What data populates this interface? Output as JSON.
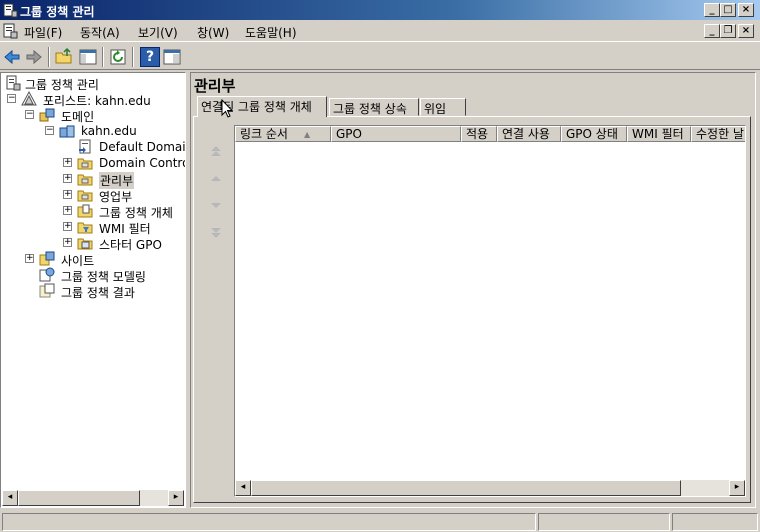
{
  "window": {
    "title": "그룹 정책 관리",
    "minimize": "_",
    "maximize": "□",
    "close": "×",
    "doc_minimize": "_",
    "doc_restore": "❐",
    "doc_close": "×"
  },
  "menu": [
    "파일(F)",
    "동작(A)",
    "보기(V)",
    "창(W)",
    "도움말(H)"
  ],
  "toolbar": {
    "back": "back-arrow-icon",
    "forward": "forward-arrow-icon",
    "up": "up-folder-icon",
    "show_hide_tree": "console-tree-icon",
    "refresh": "refresh-icon",
    "help": "?",
    "properties": "properties-pane-icon"
  },
  "tree": [
    {
      "label": "그룹 정책 관리",
      "icon": "gpmc-root-icon",
      "expander": ""
    },
    {
      "label": "포리스트: kahn.edu",
      "icon": "forest-icon",
      "expander": "−"
    },
    {
      "label": "도메인",
      "icon": "domains-icon",
      "expander": "−"
    },
    {
      "label": "kahn.edu",
      "icon": "domain-icon",
      "expander": "−"
    },
    {
      "label": "Default Domain",
      "icon": "gpo-link-icon",
      "expander": ""
    },
    {
      "label": "Domain Contro",
      "icon": "ou-folder-icon",
      "expander": "+"
    },
    {
      "label": "관리부",
      "icon": "ou-folder-icon",
      "expander": "+"
    },
    {
      "label": "영업부",
      "icon": "ou-folder-icon",
      "expander": "+"
    },
    {
      "label": "그룹 정책 개체",
      "icon": "gpo-folder-icon",
      "expander": "+"
    },
    {
      "label": "WMI 필터",
      "icon": "wmi-filter-folder-icon",
      "expander": "+"
    },
    {
      "label": "스타터 GPO",
      "icon": "starter-gpo-folder-icon",
      "expander": "+"
    },
    {
      "label": "사이트",
      "icon": "sites-icon",
      "expander": "+"
    },
    {
      "label": "그룹 정책 모델링",
      "icon": "modeling-icon",
      "expander": ""
    },
    {
      "label": "그룹 정책 결과",
      "icon": "results-icon",
      "expander": ""
    }
  ],
  "content": {
    "title": "관리부",
    "tabs": [
      "연결된 그룹 정책 개체",
      "그룹 정책 상속",
      "위임"
    ],
    "columns": [
      "링크 순서",
      "GPO",
      "적용",
      "연결 사용",
      "GPO 상태",
      "WMI 필터",
      "수정한 날"
    ],
    "sort_arrow": "▲",
    "order_buttons": {
      "move_top": "move-to-top-icon",
      "move_up": "move-up-icon",
      "move_down": "move-down-icon",
      "move_bottom": "move-to-bottom-icon"
    }
  },
  "scroll": {
    "left": "◂",
    "right": "▸"
  }
}
